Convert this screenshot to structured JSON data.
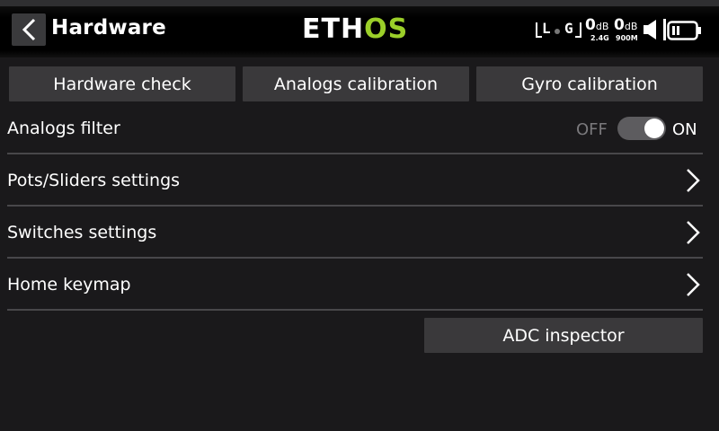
{
  "header": {
    "title": "Hardware",
    "back_icon": "chevron-left-icon",
    "logo_main": "ETH",
    "logo_accent": "OS",
    "logo_accent_color": "#9bcf29"
  },
  "status": {
    "antenna_left": "L",
    "antenna_right": "G",
    "rssi1_value": "0",
    "rssi1_unit": "dB",
    "rssi1_band": "2.4G",
    "rssi2_value": "0",
    "rssi2_unit": "dB",
    "rssi2_band": "900M",
    "volume_icon": "speaker-icon",
    "battery_icon": "battery-icon"
  },
  "buttons": {
    "hardware_check": "Hardware check",
    "analogs_calibration": "Analogs calibration",
    "gyro_calibration": "Gyro calibration",
    "adc_inspector": "ADC inspector"
  },
  "rows": {
    "analogs_filter": "Analogs filter",
    "toggle_off": "OFF",
    "toggle_on": "ON",
    "toggle_state": "ON",
    "pots_sliders": "Pots/Sliders settings",
    "switches": "Switches settings",
    "home_keymap": "Home keymap"
  }
}
